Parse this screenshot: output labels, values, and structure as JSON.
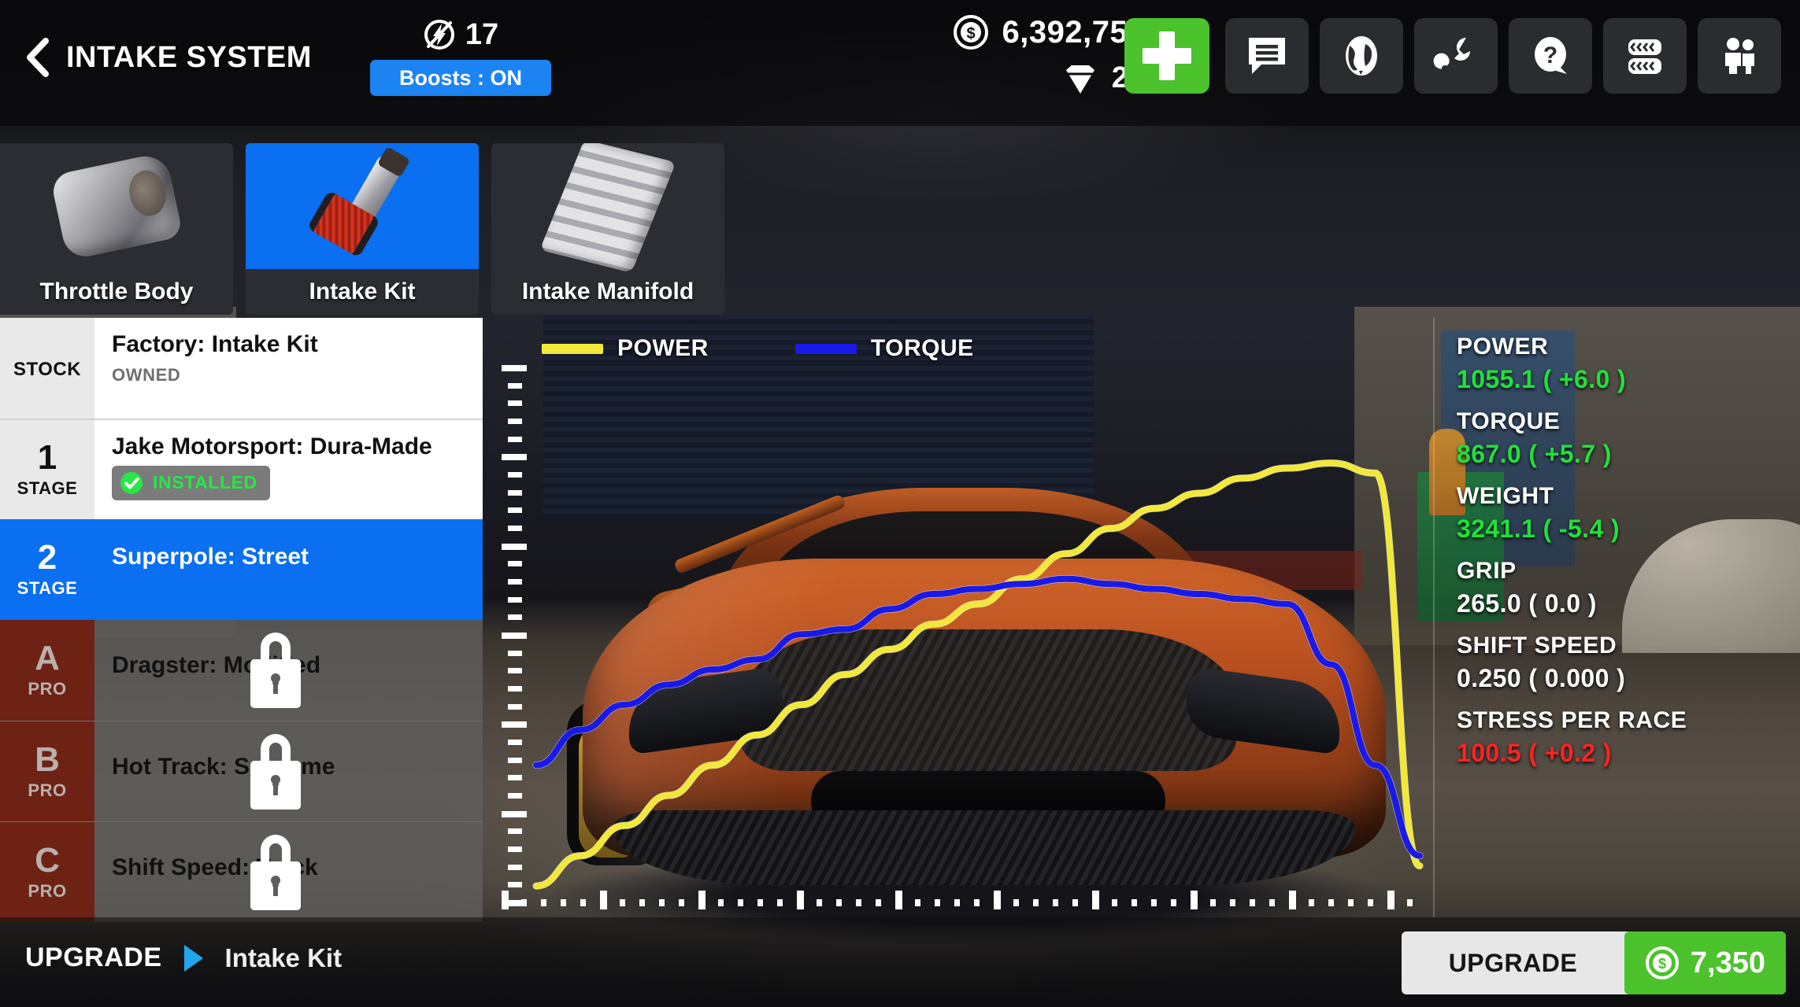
{
  "header": {
    "back_icon": "chevron-left-icon",
    "title": "INTAKE SYSTEM",
    "boost": {
      "icon": "boost-bolt-icon",
      "count": "17",
      "toggle_label": "Boosts : ON",
      "toggle_color": "#1b84f2"
    },
    "currency": {
      "cash_icon": "coin-dollar-icon",
      "cash": "6,392,753",
      "gem_icon": "gem-icon",
      "gems": "20",
      "add_label": "+",
      "add_color": "#4cc22c"
    },
    "icon_buttons": [
      {
        "name": "chat-icon",
        "label": "Chat"
      },
      {
        "name": "globe-icon",
        "label": "World"
      },
      {
        "name": "wrench-icon",
        "label": "Garage"
      },
      {
        "name": "question-help-icon",
        "label": "Help"
      },
      {
        "name": "tires-icon",
        "label": "Tires"
      },
      {
        "name": "crew-people-icon",
        "label": "Crew"
      }
    ]
  },
  "part_tabs": [
    {
      "label": "Throttle Body",
      "icon": "throttle-body-icon",
      "selected": false
    },
    {
      "label": "Intake Kit",
      "icon": "intake-kit-icon",
      "selected": true
    },
    {
      "label": "Intake Manifold",
      "icon": "intake-manifold-icon",
      "selected": false
    }
  ],
  "upgrade_list": [
    {
      "tag_num": "",
      "tag_sub": "STOCK",
      "name": "Factory: Intake Kit",
      "status": "OWNED",
      "state": "stock"
    },
    {
      "tag_num": "1",
      "tag_sub": "STAGE",
      "name": "Jake Motorsport: Dura-Made",
      "status": "INSTALLED",
      "state": "installed"
    },
    {
      "tag_num": "2",
      "tag_sub": "STAGE",
      "name": "Superpole: Street",
      "status": "",
      "state": "selected"
    },
    {
      "tag_num": "A",
      "tag_sub": "PRO",
      "name": "Dragster: Modified",
      "status": "",
      "state": "locked"
    },
    {
      "tag_num": "B",
      "tag_sub": "PRO",
      "name": "Hot Track: Supreme",
      "status": "",
      "state": "locked"
    },
    {
      "tag_num": "C",
      "tag_sub": "PRO",
      "name": "Shift Speed: Track",
      "status": "",
      "state": "locked"
    }
  ],
  "chart_data": {
    "type": "line",
    "title": "",
    "xlabel": "",
    "ylabel": "",
    "grid": false,
    "legend_position": "top-left",
    "legend": [
      {
        "name": "POWER",
        "color": "#f2e83c"
      },
      {
        "name": "TORQUE",
        "color": "#1a1ae8"
      }
    ],
    "x": [
      0,
      5,
      10,
      15,
      20,
      25,
      30,
      35,
      40,
      45,
      50,
      55,
      60,
      65,
      70,
      75,
      80,
      85,
      90,
      95,
      100
    ],
    "xlim": [
      0,
      100
    ],
    "ylim": [
      0,
      100
    ],
    "series": [
      {
        "name": "POWER",
        "color": "#f2e83c",
        "values": [
          2,
          8,
          14,
          20,
          26,
          32,
          38,
          44,
          49,
          54,
          58,
          63,
          68,
          73,
          77,
          80,
          83,
          85,
          86,
          84,
          6
        ]
      },
      {
        "name": "TORQUE",
        "color": "#1a1ae8",
        "values": [
          26,
          33,
          38,
          42,
          45,
          47,
          52,
          53,
          57,
          60,
          61,
          62,
          63,
          62,
          61,
          60,
          59,
          58,
          46,
          26,
          8
        ]
      }
    ],
    "x_ticks_major_every": 5,
    "y_ticks_major_every": 5
  },
  "stats": [
    {
      "key": "POWER",
      "value": "1055.1 ( +6.0 )",
      "trend": "up"
    },
    {
      "key": "TORQUE",
      "value": "867.0 ( +5.7 )",
      "trend": "up"
    },
    {
      "key": "WEIGHT",
      "value": "3241.1 ( -5.4 )",
      "trend": "up"
    },
    {
      "key": "GRIP",
      "value": "265.0 ( 0.0 )",
      "trend": "neutral"
    },
    {
      "key": "SHIFT SPEED",
      "value": "0.250 ( 0.000 )",
      "trend": "neutral"
    },
    {
      "key": "STRESS PER RACE",
      "value": "100.5 ( +0.2 )",
      "trend": "down"
    }
  ],
  "footer": {
    "upgrade_word": "UPGRADE",
    "arrow_icon": "triangle-right-icon",
    "part_name": "Intake Kit",
    "button_label": "UPGRADE",
    "price_icon": "coin-dollar-icon",
    "price": "7,350",
    "price_color": "#4cc22c"
  },
  "colors": {
    "accent_blue": "#0a6ff0",
    "green": "#4cc22c",
    "stat_up": "#22e03c",
    "stat_down": "#ff2424",
    "pro_red": "#6e2213"
  }
}
